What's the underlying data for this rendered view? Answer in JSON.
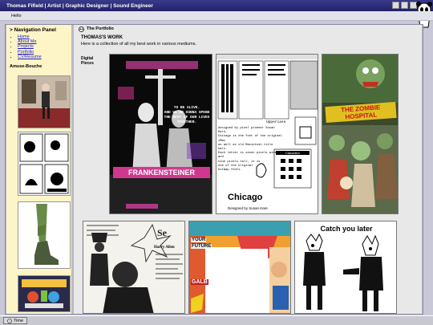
{
  "window": {
    "title": "Thomas Fifield | Artist | Graphic Designer | Sound Engineer"
  },
  "menu": {
    "items": [
      "Hello"
    ]
  },
  "sidebar": {
    "heading": "> Navigation Panel",
    "links": [
      "Home",
      "About Me",
      "Projects",
      "Portfolio",
      "CV/Resume"
    ],
    "amuse_heading": "Amuse-Bouche"
  },
  "content": {
    "header_label": "The Portfolio",
    "title": "THOMAS'S WORK",
    "description": "Here is a collection of all my best work in various mediums.",
    "category": "Digital Pieces"
  },
  "artworks": {
    "poster": {
      "lines": [
        "TO BE ALIVE.",
        "AND WE'RE GONNA SPEND",
        "THE REST OF OUR LIVES",
        "TOGETHER."
      ],
      "banner": "FRANKENSTEINER"
    },
    "typography": {
      "big": "Chicago",
      "caption": "Designed by Susan Kare",
      "calc": "Calculator",
      "sub": "Uppercase",
      "body": [
        "designed by pixel pioneer Susan Kare,",
        "Chicago is the font of the original iMac",
        "as well as old Macintosh title bars.",
        "Each letter is seven pixels wide and",
        "nine pixels tall, it is",
        "one of the original",
        "bitmap fonts."
      ]
    },
    "zombie": {
      "headline": "THE ZOMBIE HOSPITAL"
    },
    "newspaper": {
      "name": "Harry Allen"
    },
    "comic": {
      "words": [
        "YOUR",
        "FUTURE",
        "GALB"
      ]
    },
    "catch": {
      "headline": "Catch you later"
    }
  },
  "taskbar": {
    "items": [
      "Time"
    ]
  }
}
